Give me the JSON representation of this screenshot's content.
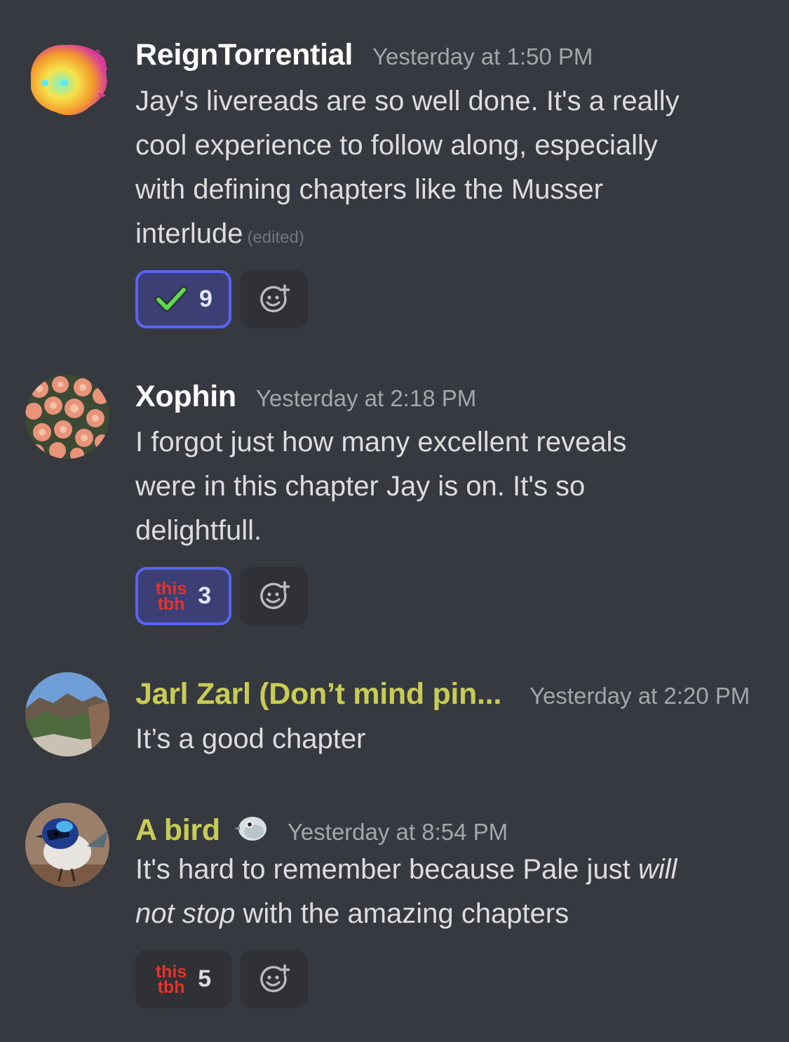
{
  "messages": [
    {
      "username": "ReignTorrential",
      "timestamp": "Yesterday at 1:50 PM",
      "lines": [
        "Jay's livereads are so well done. It's a really",
        "cool experience to follow along, especially",
        "with defining chapters like the Musser",
        "interlude"
      ],
      "edited_label": "(edited)",
      "reaction": {
        "emoji": "check-mark",
        "count": "9"
      }
    },
    {
      "username": "Xophin",
      "timestamp": "Yesterday at 2:18 PM",
      "lines": [
        "I forgot just how many excellent reveals",
        "were in this chapter Jay is on. It's so",
        "delightfull."
      ],
      "reaction": {
        "emoji_line1": "this",
        "emoji_line2": "tbh",
        "count": "3"
      }
    },
    {
      "username": "Jarl Zarl (Don’t mind pin...",
      "timestamp": "Yesterday at 2:20 PM",
      "lines": [
        "It’s a good chapter"
      ]
    },
    {
      "username": "A bird",
      "timestamp": "Yesterday at 8:54 PM",
      "line1_plain": "It's hard to remember because Pale just ",
      "line1_italic": "will",
      "line2_italic": "not stop",
      "line2_plain": " with the amazing chapters",
      "reaction": {
        "emoji_line1": "this",
        "emoji_line2": "tbh",
        "count": "5"
      }
    }
  ],
  "icons": {
    "add_reaction": "add-reaction-icon",
    "check": "check-mark-icon",
    "bird_badge": "bird-icon"
  },
  "colors": {
    "background": "#36393f",
    "role_yellow": "#c8cc54",
    "reacted_border": "#5865f2"
  }
}
